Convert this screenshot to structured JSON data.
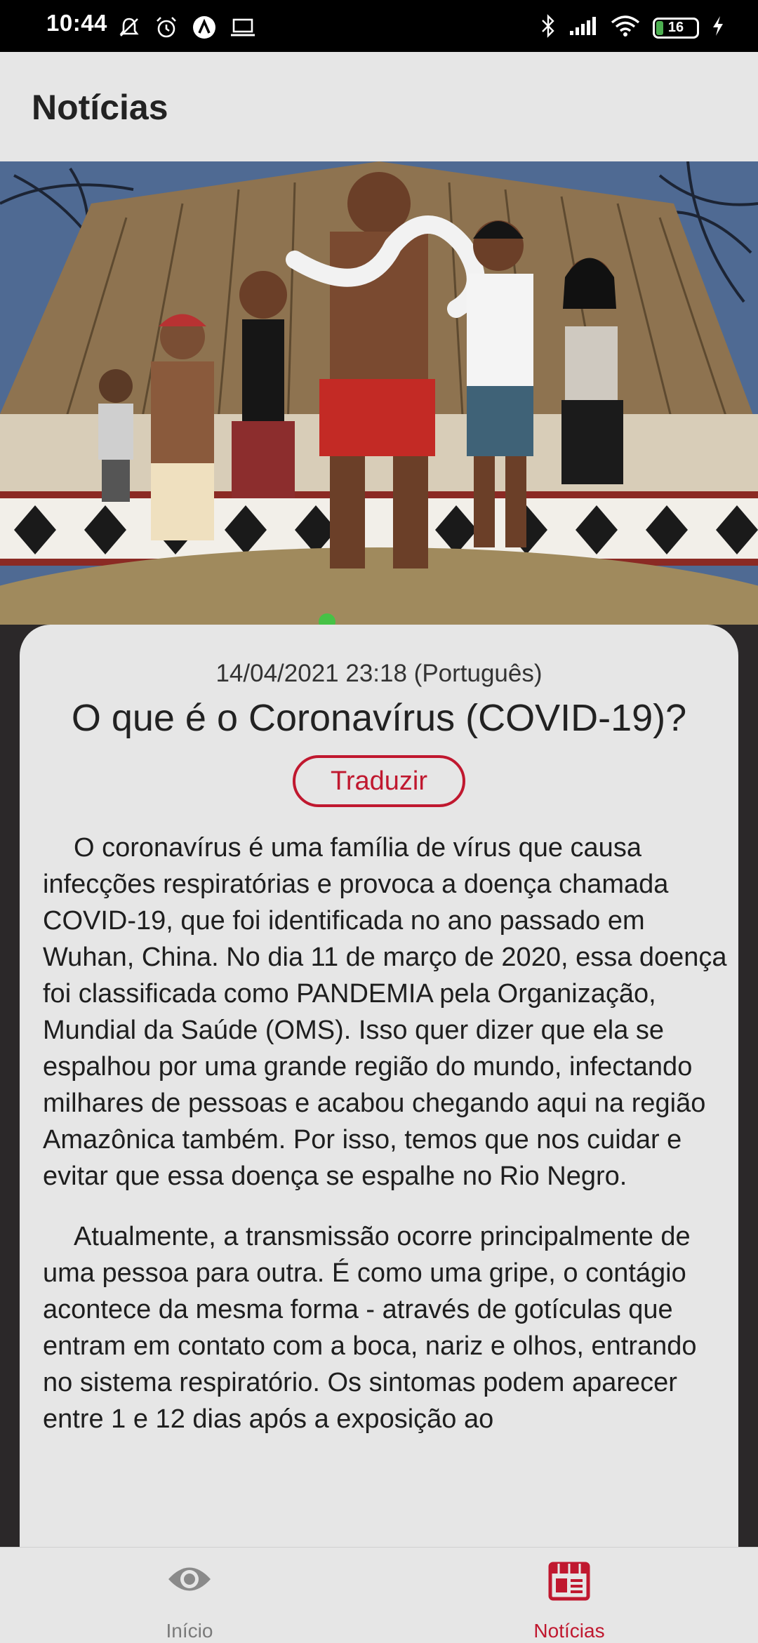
{
  "status_bar": {
    "time": "10:44",
    "battery_level": "16",
    "left_icons": [
      "bell-off-icon",
      "alarm-icon",
      "app-a-icon",
      "laptop-icon"
    ],
    "right_icons": [
      "bluetooth-icon",
      "signal-icon",
      "wifi-icon",
      "battery-icon",
      "charging-icon"
    ]
  },
  "app_bar": {
    "title": "Notícias"
  },
  "article": {
    "meta": "14/04/2021 23:18 (Português)",
    "title": "O que é o Coronavírus (COVID-19)?",
    "translate_label": "Traduzir",
    "paragraphs": [
      "O coronavírus é uma família de vírus que causa infecções respiratórias e provoca a doença chamada COVID-19, que foi identificada no ano passado em Wuhan, China. No dia 11 de março de 2020, essa doença foi classificada como PANDEMIA pela Organização, Mundial da Saúde (OMS). Isso quer dizer que ela se espalhou por uma grande região do mundo, infectando milhares de pessoas e acabou chegando aqui na região Amazônica também. Por isso, temos que nos cuidar e evitar que essa doença se espalhe no Rio Negro.",
      "Atualmente, a transmissão ocorre principalmente de uma pessoa para outra. É como uma gripe, o contágio acontece da mesma forma - através de gotículas que entram em contato com a boca, nariz e olhos, entrando no sistema respiratório. Os sintomas podem aparecer entre 1 e 12 dias após a exposição ao"
    ]
  },
  "bottom_nav": {
    "items": [
      {
        "label": "Início",
        "icon": "eye-icon",
        "active": false
      },
      {
        "label": "Notícias",
        "icon": "newspaper-icon",
        "active": true
      }
    ]
  },
  "colors": {
    "accent": "#c0182f",
    "surface": "#e6e6e6",
    "background": "#2b2829",
    "status_bar": "#000000",
    "inactive_icon": "#8a8a8a"
  }
}
